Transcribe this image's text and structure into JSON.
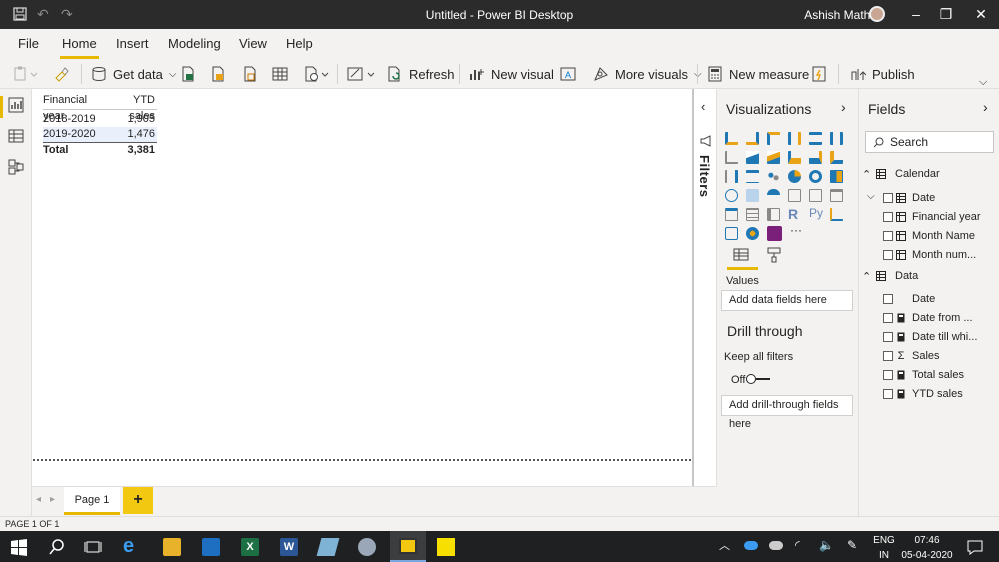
{
  "window": {
    "title": "Untitled - Power BI Desktop",
    "user": "Ashish Mathur"
  },
  "ribbon_tabs": [
    "File",
    "Home",
    "Insert",
    "Modeling",
    "View",
    "Help"
  ],
  "active_tab": "Home",
  "ribbon": {
    "get_data": "Get data",
    "refresh": "Refresh",
    "new_visual": "New visual",
    "more_visuals": "More visuals",
    "new_measure": "New measure",
    "publish": "Publish"
  },
  "table": {
    "headers": [
      "Financial year",
      "YTD sales"
    ],
    "rows": [
      [
        "2018-2019",
        "1,905"
      ],
      [
        "2019-2020",
        "1,476"
      ]
    ],
    "total": [
      "Total",
      "3,381"
    ]
  },
  "filters": {
    "label": "Filters"
  },
  "visualizations": {
    "title": "Visualizations",
    "values_label": "Values",
    "values_placeholder": "Add data fields here",
    "drill_title": "Drill through",
    "keep_filters": "Keep all filters",
    "toggle_state": "Off",
    "drill_placeholder": "Add drill-through fields here",
    "extra_icons": {
      "r": "R",
      "py": "Py",
      "more": "···"
    }
  },
  "fields": {
    "title": "Fields",
    "search_placeholder": "Search",
    "tables": [
      {
        "name": "Calendar",
        "items": [
          {
            "label": "Date",
            "icon": "hierarchy-icon"
          },
          {
            "label": "Financial year",
            "icon": "column-icon"
          },
          {
            "label": "Month Name",
            "icon": "column-icon"
          },
          {
            "label": "Month num...",
            "icon": "column-icon"
          }
        ]
      },
      {
        "name": "Data",
        "items": [
          {
            "label": "Date",
            "icon": "none"
          },
          {
            "label": "Date from ...",
            "icon": "measure-icon"
          },
          {
            "label": "Date till whi...",
            "icon": "measure-icon"
          },
          {
            "label": "Sales",
            "icon": "sigma-icon"
          },
          {
            "label": "Total sales",
            "icon": "measure-icon"
          },
          {
            "label": "YTD sales",
            "icon": "measure-icon"
          }
        ]
      }
    ]
  },
  "pages": {
    "tab": "Page 1",
    "add": "+"
  },
  "status": "PAGE 1 OF 1",
  "tray": {
    "lang1": "ENG",
    "lang2": "IN",
    "time": "07:46",
    "date": "05-04-2020"
  }
}
